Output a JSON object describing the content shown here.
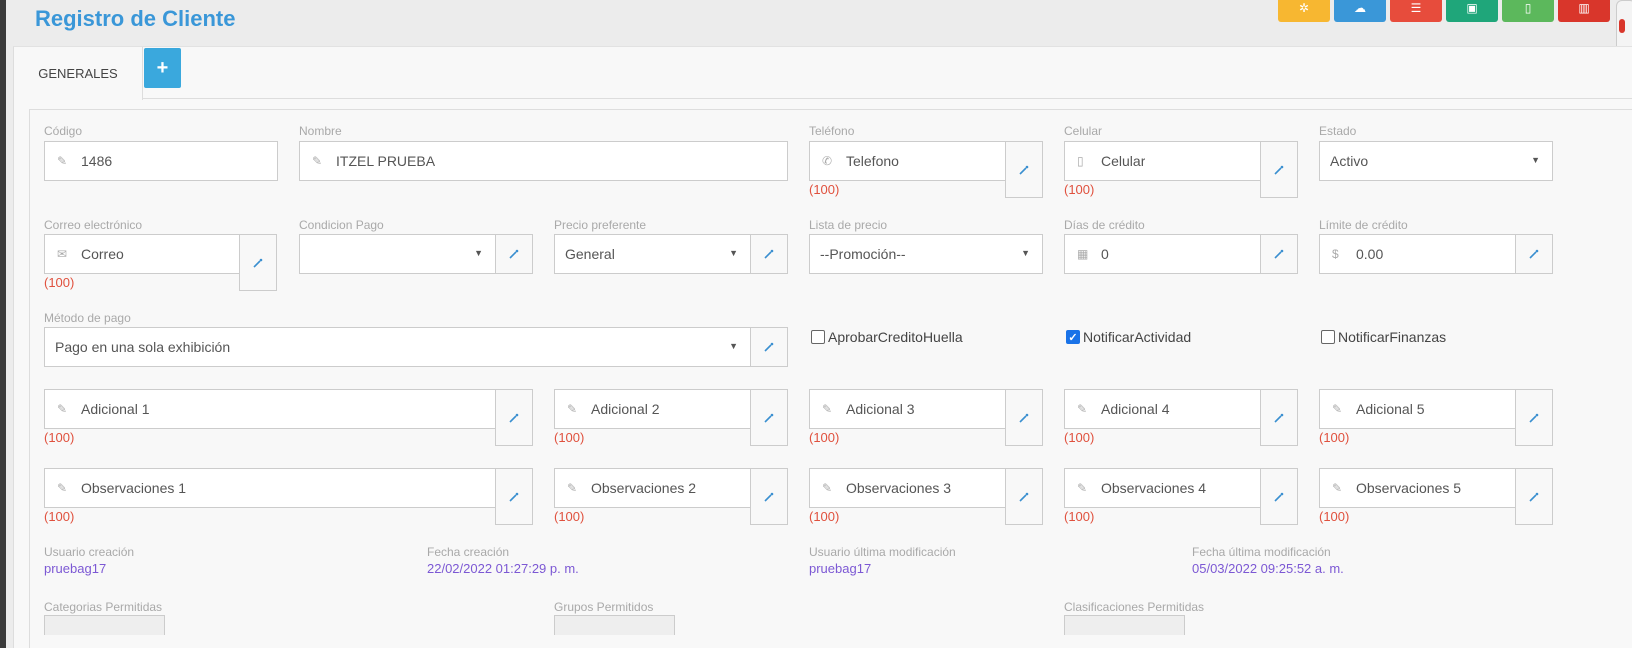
{
  "page": {
    "title": "Registro de Cliente"
  },
  "toolbar": {
    "buttons": [
      {
        "icon": "gears-icon",
        "color": "#f7b731"
      },
      {
        "icon": "cloud-upload-icon",
        "color": "#3a97d8"
      },
      {
        "icon": "list-icon",
        "color": "#e74c3c"
      },
      {
        "icon": "save-icon",
        "color": "#1fa67a"
      },
      {
        "icon": "new-file-icon",
        "color": "#5cb85c"
      },
      {
        "icon": "trash-icon",
        "color": "#d9362b"
      }
    ]
  },
  "tabs": {
    "generales": "GENERALES",
    "add_label": "+"
  },
  "fields": {
    "codigo": {
      "label": "Código",
      "value": "1486"
    },
    "nombre": {
      "label": "Nombre",
      "value": "ITZEL PRUEBA"
    },
    "telefono": {
      "label": "Teléfono",
      "placeholder": "Telefono",
      "count": "(100)"
    },
    "celular": {
      "label": "Celular",
      "placeholder": "Celular",
      "count": "(100)"
    },
    "estado": {
      "label": "Estado",
      "value": "Activo"
    },
    "correo": {
      "label": "Correo electrónico",
      "placeholder": "Correo",
      "count": "(100)"
    },
    "condicion_pago": {
      "label": "Condicion Pago",
      "value": ""
    },
    "precio_preferente": {
      "label": "Precio preferente",
      "value": "General"
    },
    "lista_precio": {
      "label": "Lista de precio",
      "value": "--Promoción--"
    },
    "dias_credito": {
      "label": "Días de crédito",
      "value": "0"
    },
    "limite_credito": {
      "label": "Límite de crédito",
      "value": "0.00"
    },
    "metodo_pago": {
      "label": "Método de pago",
      "value": "Pago en una sola exhibición"
    }
  },
  "checkboxes": {
    "aprobar": {
      "label": "AprobarCreditoHuella",
      "checked": false
    },
    "notificar_actividad": {
      "label": "NotificarActividad",
      "checked": true
    },
    "notificar_finanzas": {
      "label": "NotificarFinanzas",
      "checked": false
    }
  },
  "adicionales": [
    {
      "placeholder": "Adicional 1",
      "count": "(100)"
    },
    {
      "placeholder": "Adicional 2",
      "count": "(100)"
    },
    {
      "placeholder": "Adicional 3",
      "count": "(100)"
    },
    {
      "placeholder": "Adicional 4",
      "count": "(100)"
    },
    {
      "placeholder": "Adicional 5",
      "count": "(100)"
    }
  ],
  "observaciones": [
    {
      "placeholder": "Observaciones 1",
      "count": "(100)"
    },
    {
      "placeholder": "Observaciones 2",
      "count": "(100)"
    },
    {
      "placeholder": "Observaciones 3",
      "count": "(100)"
    },
    {
      "placeholder": "Observaciones 4",
      "count": "(100)"
    },
    {
      "placeholder": "Observaciones 5",
      "count": "(100)"
    }
  ],
  "audit": {
    "usuario_creacion": {
      "label": "Usuario creación",
      "value": "pruebag17"
    },
    "fecha_creacion": {
      "label": "Fecha creación",
      "value": "22/02/2022 01:27:29 p. m."
    },
    "usuario_mod": {
      "label": "Usuario última modificación",
      "value": "pruebag17"
    },
    "fecha_mod": {
      "label": "Fecha última modificación",
      "value": "05/03/2022 09:25:52 a. m."
    }
  },
  "permissions": {
    "categorias": "Categorias Permitidas",
    "grupos": "Grupos Permitidos",
    "clasificaciones": "Clasificaciones Permitidas"
  }
}
